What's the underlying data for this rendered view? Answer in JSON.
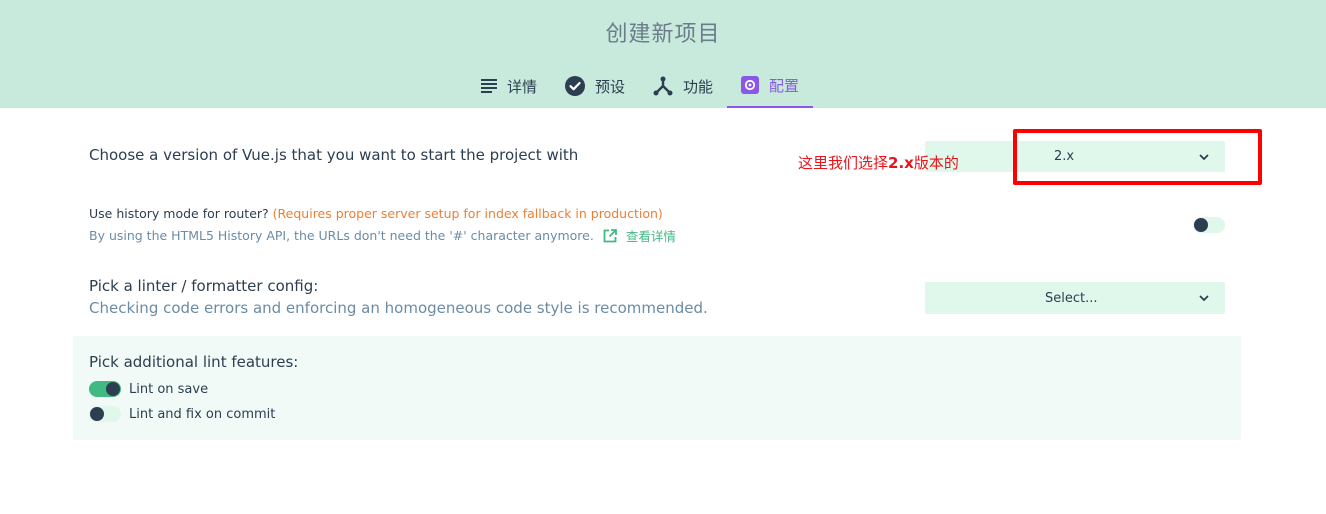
{
  "header": {
    "title": "创建新项目",
    "tabs": [
      {
        "label": "详情",
        "icon": "list-icon",
        "active": false
      },
      {
        "label": "预设",
        "icon": "check-circle-icon",
        "active": false
      },
      {
        "label": "功能",
        "icon": "fork-icon",
        "active": false
      },
      {
        "label": "配置",
        "icon": "settings-icon",
        "active": true
      }
    ]
  },
  "vue_version": {
    "label": "Choose a version of Vue.js that you want to start the project with",
    "selected": "2.x"
  },
  "annotation": {
    "prefix": "这里我们选择",
    "bold": "2.x",
    "suffix": "版本的"
  },
  "history_mode": {
    "label": "Use history mode for router?",
    "warning": "(Requires proper server setup for index fallback in production)",
    "description": "By using the HTML5 History API, the URLs don't need the '#' character anymore.",
    "link_label": "查看详情",
    "enabled": false
  },
  "linter": {
    "label": "Pick a linter / formatter config:",
    "description": "Checking code errors and enforcing an homogeneous code style is recommended.",
    "placeholder": "Select..."
  },
  "lint_features": {
    "title": "Pick additional lint features:",
    "options": [
      {
        "label": "Lint on save",
        "enabled": true
      },
      {
        "label": "Lint and fix on commit",
        "enabled": false
      }
    ]
  },
  "colors": {
    "header_bg": "#c8eadd",
    "accent_purple": "#8a57e8",
    "accent_green": "#42b983",
    "warning_orange": "#ec7f34",
    "annotation_red": "#ff0000"
  }
}
